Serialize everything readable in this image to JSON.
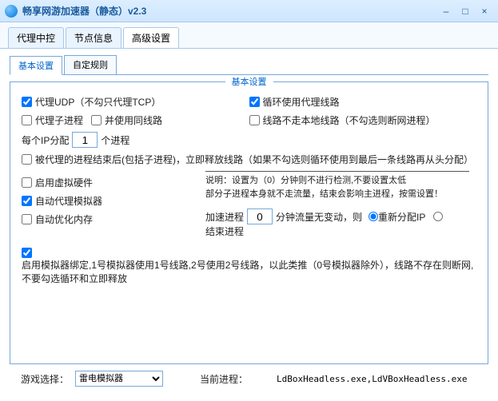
{
  "window": {
    "title": "畅享网游加速器（静态）v2.3",
    "min": "–",
    "max": "□",
    "close": "×"
  },
  "main_tabs": {
    "items": [
      {
        "label": "代理中控"
      },
      {
        "label": "节点信息"
      },
      {
        "label": "高级设置"
      }
    ]
  },
  "sub_tabs": {
    "items": [
      {
        "label": "基本设置"
      },
      {
        "label": "自定规则"
      }
    ]
  },
  "fieldset_title": "基本设置",
  "opts": {
    "proxy_udp": "代理UDP（不勾只代理TCP）",
    "loop_proxy": "循环使用代理线路",
    "proxy_child": "代理子进程",
    "use_same_line": "并使用同线路",
    "line_no_local": "线路不走本地线路（不勾选则断网进程）",
    "per_ip_prefix": "每个IP分配",
    "per_ip_value": "1",
    "per_ip_suffix": "个进程",
    "release_line": "被代理的进程结束后(包括子进程)，立即释放线路（如果不勾选则循环使用到最后一条线路再从头分配）",
    "enable_vhw": "启用虚拟硬件",
    "auto_proxy_emulator": "自动代理模拟器",
    "auto_opt_mem": "自动优化内存",
    "emulator_bind": "启用模拟器绑定,1号模拟器使用1号线路,2号使用2号线路，以此类推（0号模拟器除外），线路不存在则断网,不要勾选循环和立即释放",
    "explain_label": "说明：",
    "explain_line1": "设置为（0）分钟则不进行检测,不要设置太低",
    "explain_line2": "部分子进程本身就不走流量，结束会影响主进程，按需设置！",
    "accel_prefix": "加速进程",
    "accel_value": "0",
    "accel_suffix": "分钟流量无变动，则",
    "radio_reassign": "重新分配IP",
    "radio_end": "结束进程"
  },
  "bottom": {
    "game_select_label": "游戏选择：",
    "game_select_value": "雷电模拟器",
    "current_proc_label": "当前进程：",
    "current_proc_value": "LdBoxHeadless.exe,LdVBoxHeadless.exe"
  }
}
